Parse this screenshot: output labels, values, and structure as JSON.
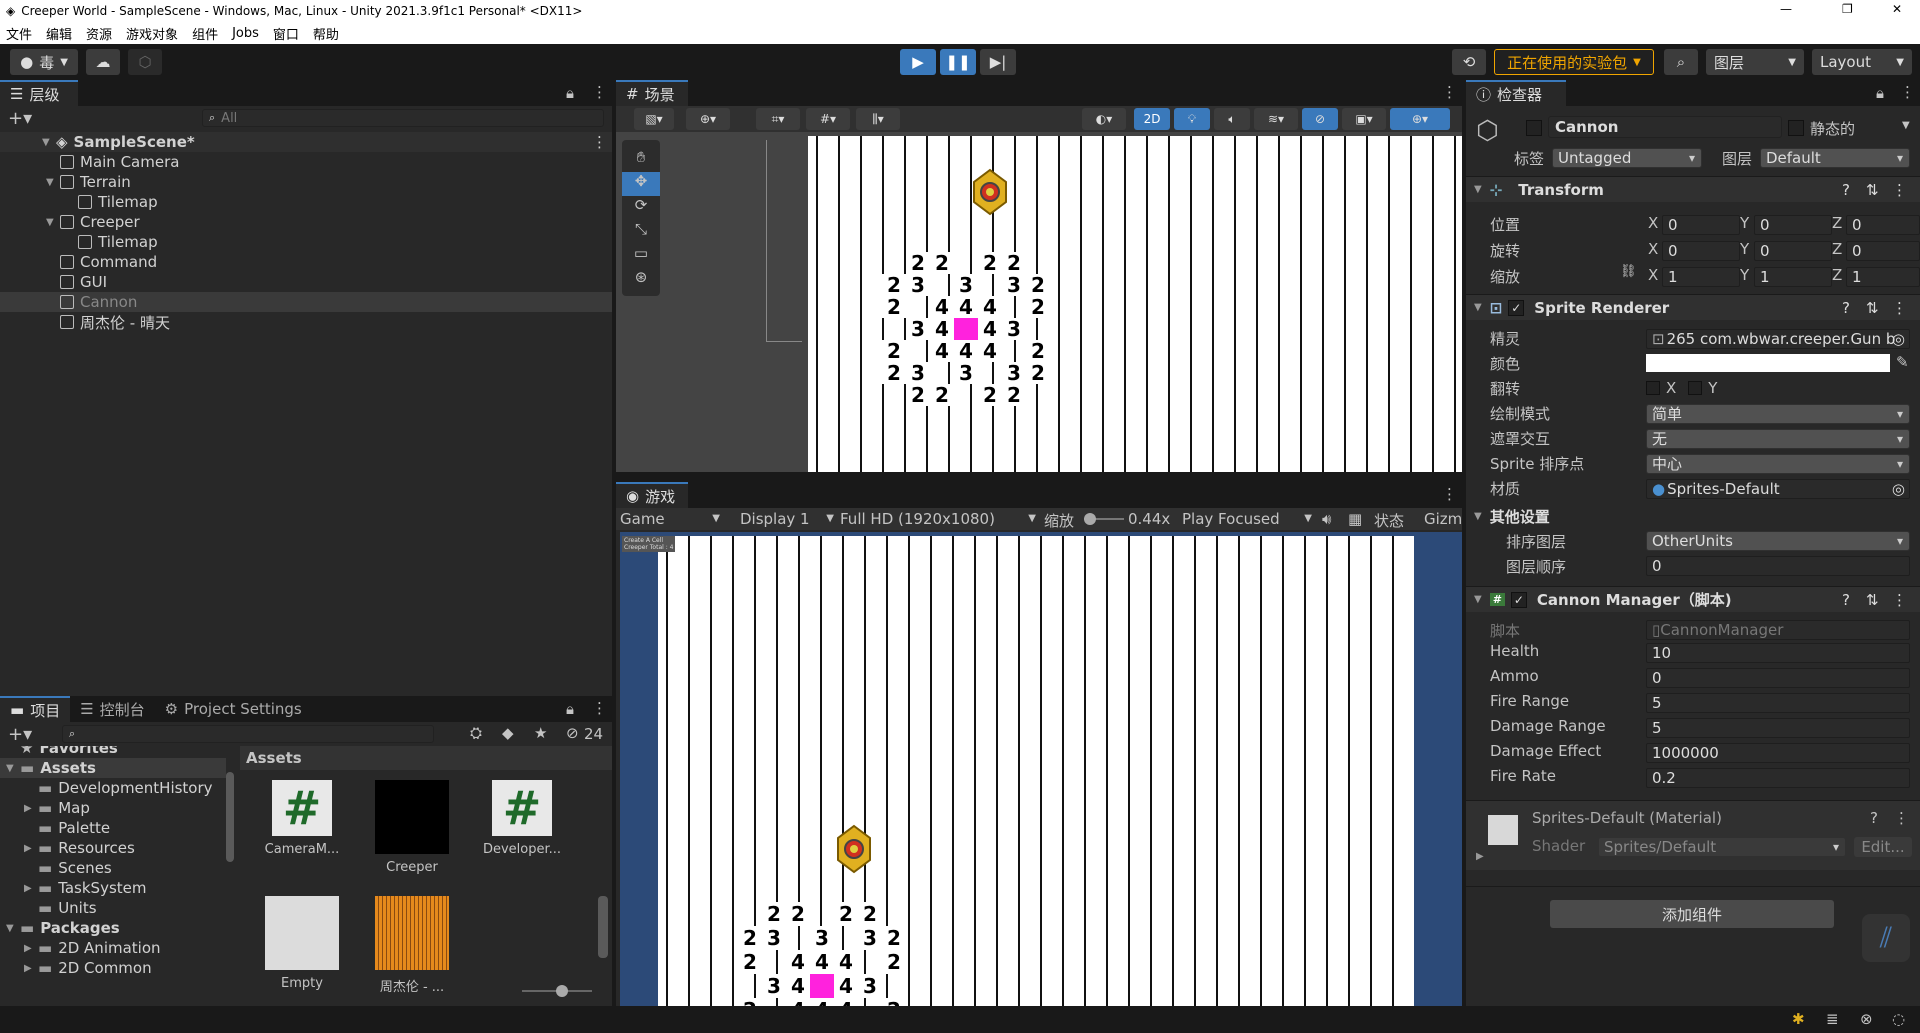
{
  "window": {
    "title": "Creeper World - SampleScene - Windows, Mac, Linux - Unity 2021.3.9f1c1 Personal* <DX11>",
    "min": "—",
    "max": "❐",
    "close": "✕"
  },
  "menu": [
    "文件",
    "编辑",
    "资源",
    "游戏对象",
    "组件",
    "Jobs",
    "窗口",
    "帮助"
  ],
  "toolbar": {
    "account": "毒",
    "experimental": "正在使用的实验包",
    "layers": "图层",
    "layout": "Layout"
  },
  "hierarchy": {
    "tab": "层级",
    "search_placeholder": "All",
    "scene": "SampleScene*",
    "items": [
      {
        "label": "Main Camera",
        "indent": 1,
        "expand": ""
      },
      {
        "label": "Terrain",
        "indent": 1,
        "expand": "▼"
      },
      {
        "label": "Tilemap",
        "indent": 2,
        "expand": ""
      },
      {
        "label": "Creeper",
        "indent": 1,
        "expand": "▼"
      },
      {
        "label": "Tilemap",
        "indent": 2,
        "expand": ""
      },
      {
        "label": "Command",
        "indent": 1,
        "expand": ""
      },
      {
        "label": "GUI",
        "indent": 1,
        "expand": ""
      },
      {
        "label": "Cannon",
        "indent": 1,
        "expand": ""
      },
      {
        "label": "周杰伦 - 晴天",
        "indent": 1,
        "expand": ""
      }
    ]
  },
  "project": {
    "tabs": [
      "项目",
      "控制台",
      "Project Settings"
    ],
    "hidden_count": "24",
    "tree": [
      {
        "label": "Favorites",
        "indent": 0,
        "bold": true
      },
      {
        "label": "Assets",
        "indent": 0,
        "bold": true
      },
      {
        "label": "DevelopmentHistory",
        "indent": 1
      },
      {
        "label": "Map",
        "indent": 1
      },
      {
        "label": "Palette",
        "indent": 1
      },
      {
        "label": "Resources",
        "indent": 1
      },
      {
        "label": "Scenes",
        "indent": 1
      },
      {
        "label": "TaskSystem",
        "indent": 1
      },
      {
        "label": "Units",
        "indent": 1
      },
      {
        "label": "Packages",
        "indent": 0,
        "bold": true
      },
      {
        "label": "2D Animation",
        "indent": 1
      },
      {
        "label": "2D Common",
        "indent": 1
      }
    ],
    "breadcrumb": "Assets",
    "assets": [
      "CameraM...",
      "Creeper",
      "Developer...",
      "Empty",
      "周杰伦 - ..."
    ]
  },
  "scene_view": {
    "tab": "场景",
    "mode2d": "2D"
  },
  "game_view": {
    "tab": "游戏",
    "game": "Game",
    "display": "Display 1",
    "resolution": "Full HD (1920x1080)",
    "scale_label": "缩放",
    "scale_value": "0.44x",
    "play_focused": "Play Focused",
    "stats": "状态",
    "gizmos": "Gizm",
    "hud1": "Create A Cell",
    "hud2": "Creeper Total : 4"
  },
  "numbers_grid": [
    [
      "",
      "2",
      "2",
      "",
      "2",
      "2",
      ""
    ],
    [
      "2",
      "3",
      "",
      "3",
      "",
      "3",
      "2"
    ],
    [
      "2",
      "",
      "4",
      "4",
      "4",
      "",
      "2"
    ],
    [
      "",
      "3",
      "4",
      "■",
      "4",
      "3",
      ""
    ],
    [
      "2",
      "",
      "4",
      "4",
      "4",
      "",
      "2"
    ],
    [
      "2",
      "3",
      "",
      "3",
      "",
      "3",
      "2"
    ],
    [
      "",
      "2",
      "2",
      "",
      "2",
      "2",
      ""
    ]
  ],
  "inspector": {
    "tab": "检查器",
    "object_name": "Cannon",
    "static_label": "静态的",
    "tag_label": "标签",
    "tag_value": "Untagged",
    "layer_label": "图层",
    "layer_value": "Default",
    "transform": {
      "title": "Transform",
      "position_label": "位置",
      "rotation_label": "旋转",
      "scale_label": "缩放",
      "position": [
        "0",
        "0",
        "0"
      ],
      "rotation": [
        "0",
        "0",
        "0"
      ],
      "scale": [
        "1",
        "1",
        "1"
      ]
    },
    "axes": [
      "X",
      "Y",
      "Z"
    ],
    "sprite_renderer": {
      "title": "Sprite Renderer",
      "rows": [
        {
          "label": "精灵",
          "value": "265 com.wbwar.creeper.Gun b",
          "kind": "object"
        },
        {
          "label": "颜色",
          "value": "",
          "kind": "color"
        },
        {
          "label": "翻转",
          "value": "",
          "kind": "flip"
        },
        {
          "label": "绘制模式",
          "value": "简单",
          "kind": "drop"
        },
        {
          "label": "遮罩交互",
          "value": "无",
          "kind": "drop"
        },
        {
          "label": "Sprite 排序点",
          "value": "中心",
          "kind": "drop"
        },
        {
          "label": "材质",
          "value": "Sprites-Default",
          "kind": "object"
        }
      ],
      "other_title": "其他设置",
      "sorting_layer_label": "排序图层",
      "sorting_layer_value": "OtherUnits",
      "order_label": "图层顺序",
      "order_value": "0",
      "flip_x": "X",
      "flip_y": "Y"
    },
    "cannon_manager": {
      "title": "Cannon Manager（脚本)",
      "script_label": "脚本",
      "script_value": "CannonManager",
      "fields": [
        {
          "label": "Health",
          "value": "10"
        },
        {
          "label": "Ammo",
          "value": "0"
        },
        {
          "label": "Fire Range",
          "value": "5"
        },
        {
          "label": "Damage Range",
          "value": "5"
        },
        {
          "label": "Damage Effect",
          "value": "1000000"
        },
        {
          "label": "Fire Rate",
          "value": "0.2"
        }
      ]
    },
    "material": {
      "title": "Sprites-Default (Material)",
      "shader_label": "Shader",
      "shader_value": "Sprites/Default",
      "edit": "Edit..."
    },
    "add_component": "添加组件"
  },
  "colors": {
    "accent": "#3a79bb",
    "experimental": "#f0a500",
    "creeper_pink": "#ff22dd",
    "game_bg": "#2c4a78"
  }
}
